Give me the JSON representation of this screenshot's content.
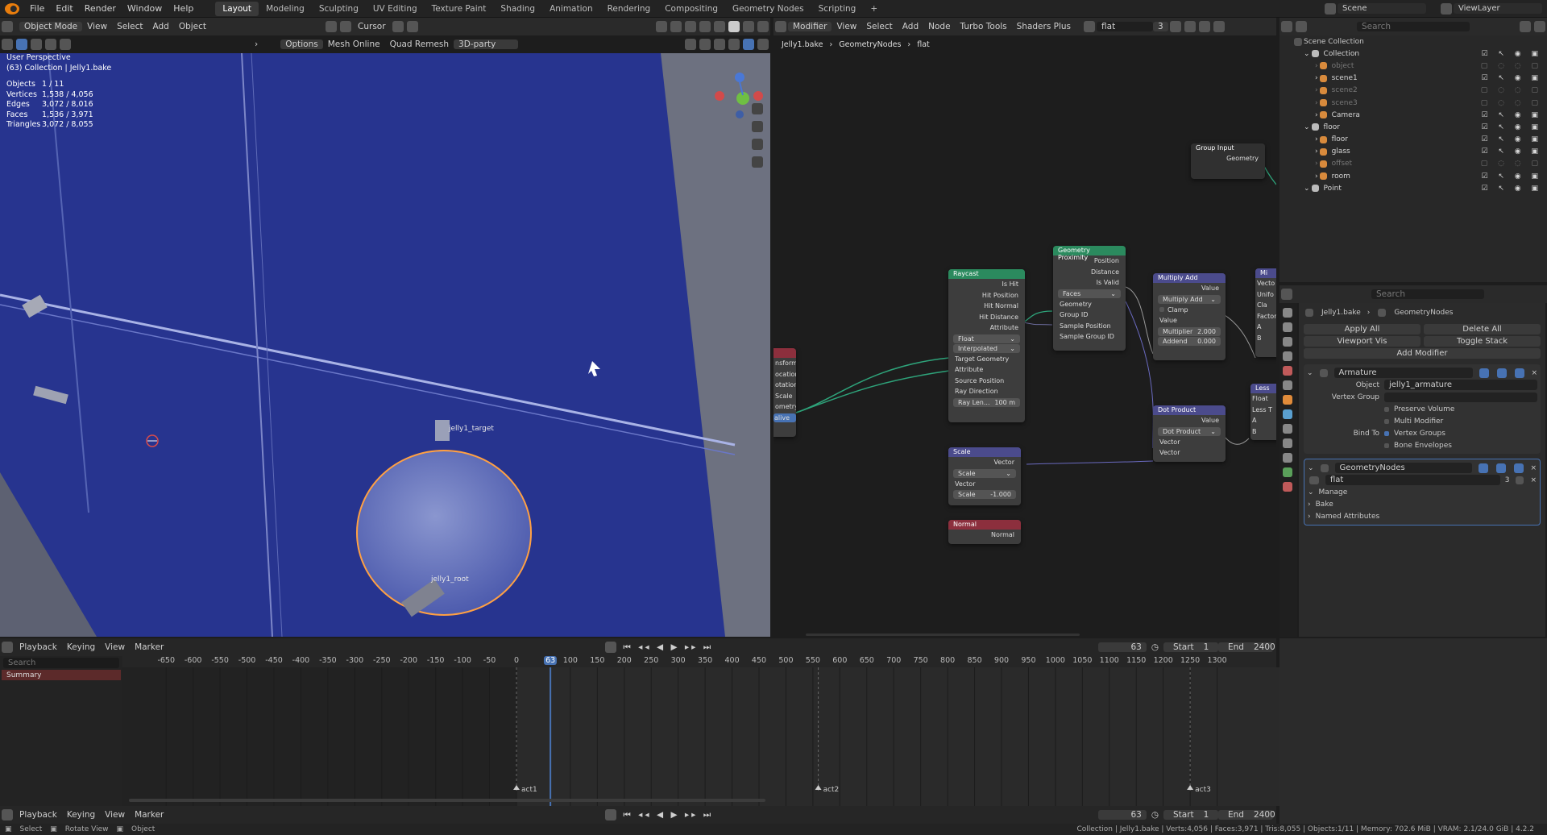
{
  "topbar": {
    "menus": [
      "File",
      "Edit",
      "Render",
      "Window",
      "Help"
    ],
    "workspaces": [
      "Layout",
      "Modeling",
      "Sculpting",
      "UV Editing",
      "Texture Paint",
      "Shading",
      "Animation",
      "Rendering",
      "Compositing",
      "Geometry Nodes",
      "Scripting"
    ],
    "active_workspace": "Layout",
    "scene": "Scene",
    "view_layer": "ViewLayer"
  },
  "viewport": {
    "header_mode": "Object Mode",
    "header_menus": [
      "View",
      "Select",
      "Add",
      "Object"
    ],
    "transform": "Cursor",
    "options": "Options",
    "addon1": "Mesh Online",
    "addon2": "Quad Remesh",
    "addon3": "3D-party",
    "perspective": "User Perspective",
    "collection": "(63) Collection | Jelly1.bake",
    "stats": [
      {
        "k": "Objects",
        "v": "1 / 11"
      },
      {
        "k": "Vertices",
        "v": "1,538 / 4,056"
      },
      {
        "k": "Edges",
        "v": "3,072 / 8,016"
      },
      {
        "k": "Faces",
        "v": "1,536 / 3,971"
      },
      {
        "k": "Triangles",
        "v": "3,072 / 8,055"
      }
    ],
    "label_target": "jelly1_target",
    "label_root": "jelly1_root"
  },
  "node_editor": {
    "header": [
      "Modifier",
      "View",
      "Select",
      "Add",
      "Node",
      "Turbo Tools",
      "Shaders Plus"
    ],
    "tree_name": "flat",
    "users": "3",
    "breadcrumb": [
      "Jelly1.bake",
      "GeometryNodes",
      "flat"
    ],
    "group_input": {
      "title": "Group Input",
      "out": "Geometry"
    },
    "raycast": {
      "title": "Raycast",
      "outs": [
        "Is Hit",
        "Hit Position",
        "Hit Normal",
        "Hit Distance",
        "Attribute"
      ],
      "type": "Float",
      "mapping": "Interpolated",
      "ins": [
        "Target Geometry",
        "Attribute",
        "Source Position",
        "Ray Direction"
      ],
      "ray_label": "Ray Len...",
      "ray_value": "100 m"
    },
    "proximity": {
      "title": "Geometry Proximity",
      "outs": [
        "Position",
        "Distance",
        "Is Valid"
      ],
      "mode": "Faces",
      "ins": [
        "Geometry",
        "Group ID",
        "Sample Position",
        "Sample Group ID"
      ]
    },
    "multiply_add": {
      "title": "Multiply Add",
      "out": "Value",
      "op": "Multiply Add",
      "clamp": "Clamp",
      "in": "Value",
      "mult_label": "Multiplier",
      "mult_value": "2.000",
      "add_label": "Addend",
      "add_value": "0.000"
    },
    "dot": {
      "title": "Dot Product",
      "out": "Value",
      "op": "Dot Product",
      "ins": [
        "Vector",
        "Vector"
      ]
    },
    "scale": {
      "title": "Scale",
      "out": "Vector",
      "op": "Scale",
      "in": "Vector",
      "f_label": "Scale",
      "f_value": "-1.000"
    },
    "normal": {
      "title": "Normal",
      "out": "Normal"
    },
    "partial_left": [
      "nsform",
      "ocation",
      "otation",
      "Scale",
      "ometry"
    ],
    "partial_left_value": "alive",
    "partial_right1": {
      "title": "Mi",
      "rows": [
        "Vecto",
        "Unifo",
        "Cla",
        "Factor",
        "A",
        "B"
      ]
    },
    "partial_right2": {
      "title": "Less",
      "rows": [
        "Float",
        "Less T",
        "A",
        "B"
      ]
    }
  },
  "outliner": {
    "search": "Search",
    "root": "Scene Collection",
    "items": [
      {
        "name": "Collection",
        "depth": 1,
        "dim": false
      },
      {
        "name": "object",
        "depth": 2,
        "dim": true
      },
      {
        "name": "scene1",
        "depth": 2,
        "dim": false
      },
      {
        "name": "scene2",
        "depth": 2,
        "dim": true
      },
      {
        "name": "scene3",
        "depth": 2,
        "dim": true
      },
      {
        "name": "Camera",
        "depth": 2,
        "dim": false
      },
      {
        "name": "floor",
        "depth": 1,
        "dim": false
      },
      {
        "name": "floor",
        "depth": 2,
        "dim": false
      },
      {
        "name": "glass",
        "depth": 2,
        "dim": false
      },
      {
        "name": "offset",
        "depth": 2,
        "dim": true
      },
      {
        "name": "room",
        "depth": 2,
        "dim": false
      },
      {
        "name": "Point",
        "depth": 1,
        "dim": false
      }
    ]
  },
  "properties": {
    "search": "Search",
    "breadcrumb": [
      "Jelly1.bake",
      "GeometryNodes"
    ],
    "apply_all": "Apply All",
    "delete_all": "Delete All",
    "viewport_vis": "Viewport Vis",
    "toggle_stack": "Toggle Stack",
    "add_modifier": "Add Modifier",
    "armature": {
      "name": "Armature",
      "object_label": "Object",
      "object_value": "jelly1_armature",
      "vgroup_label": "Vertex Group",
      "preserve_volume": "Preserve Volume",
      "multi_modifier": "Multi Modifier",
      "bind_to": "Bind To",
      "vertex_groups": "Vertex Groups",
      "bone_envelopes": "Bone Envelopes"
    },
    "geonodes": {
      "name": "GeometryNodes",
      "tree": "flat",
      "users": "3",
      "sections": [
        "Manage",
        "Bake",
        "Named Attributes"
      ]
    }
  },
  "timeline": {
    "menus": [
      "Playback",
      "Keying",
      "View",
      "Marker"
    ],
    "current_frame": "63",
    "start_label": "Start",
    "start": "1",
    "end_label": "End",
    "end": "2400",
    "search": "Search",
    "summary": "Summary",
    "ticks": [
      "-650",
      "-600",
      "-550",
      "-500",
      "-450",
      "-400",
      "-350",
      "-300",
      "-250",
      "-200",
      "-150",
      "-100",
      "-50",
      "0",
      "63",
      "100",
      "150",
      "200",
      "250",
      "300",
      "350",
      "400",
      "450",
      "500",
      "550",
      "600",
      "650",
      "700",
      "750",
      "800",
      "850",
      "900",
      "950",
      "1000",
      "1050",
      "1100",
      "1150",
      "1200",
      "1250",
      "1300"
    ],
    "markers": [
      {
        "name": "act1",
        "frame": 0
      },
      {
        "name": "act2",
        "frame": 560
      },
      {
        "name": "act3",
        "frame": 1250
      }
    ]
  },
  "status": {
    "left": [
      "Select",
      "Rotate View",
      "Object"
    ],
    "right": "Collection | Jelly1.bake | Verts:4,056 | Faces:3,971 | Tris:8,055 | Objects:1/11 | Memory: 702.6 MiB | VRAM: 2.1/24.0 GiB | 4.2.2"
  },
  "colors": {
    "viewport_bg": "#27348f",
    "selection": "#ff9a3c",
    "accent": "#4772b3",
    "node_green": "#2b8a5e",
    "node_purple": "#4b4b8c",
    "node_red": "#8c2f3d"
  }
}
